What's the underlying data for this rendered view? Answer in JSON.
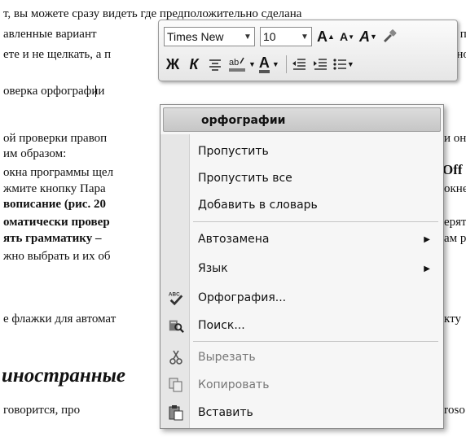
{
  "document": {
    "lines": [
      {
        "text": "т, вы можете сразу видеть где предположительно сделана"
      },
      {
        "text": "авленные вариант"
      },
      {
        "text": "ете и не щелкать, а п"
      },
      {
        "text": "оверка орфографии"
      },
      {
        "text": "ой проверки правоп"
      },
      {
        "text": "им образом:"
      },
      {
        "text": "окна программы щел"
      },
      {
        "text": "жмите кнопку Пара"
      },
      {
        "text": "вописание (рис. 20"
      },
      {
        "text": "оматически провер"
      },
      {
        "text": "ять грамматику –"
      },
      {
        "text": "жно выбрать и их об"
      },
      {
        "text": "е флажки для автомат"
      },
      {
        "text": "иностранные"
      },
      {
        "text": "говорится, про"
      }
    ],
    "right_fragments": [
      "й п",
      "льно",
      "и он",
      "Off",
      "окне",
      "ерят",
      "ам р",
      "кту",
      "roso"
    ]
  },
  "toolbar": {
    "font_name": "Times New",
    "font_size": "10",
    "grow_font": "A",
    "shrink_font": "A",
    "styles": "A",
    "bold": "Ж",
    "italic": "К",
    "font_color": "A"
  },
  "menu": {
    "suggestion": "орфографии",
    "items": [
      {
        "label": "Пропустить",
        "icon": ""
      },
      {
        "label": "Пропустить все",
        "icon": ""
      },
      {
        "label": "Добавить в словарь",
        "icon": ""
      },
      {
        "label": "Автозамена",
        "icon": "",
        "submenu": true
      },
      {
        "label": "Язык",
        "icon": "",
        "submenu": true
      },
      {
        "label": "Орфография...",
        "icon": "spelling-icon"
      },
      {
        "label": "Поиск...",
        "icon": "research-icon"
      },
      {
        "label": "Вырезать",
        "icon": "cut-icon",
        "disabled": true
      },
      {
        "label": "Копировать",
        "icon": "copy-icon",
        "disabled": true
      },
      {
        "label": "Вставить",
        "icon": "paste-icon"
      }
    ]
  }
}
